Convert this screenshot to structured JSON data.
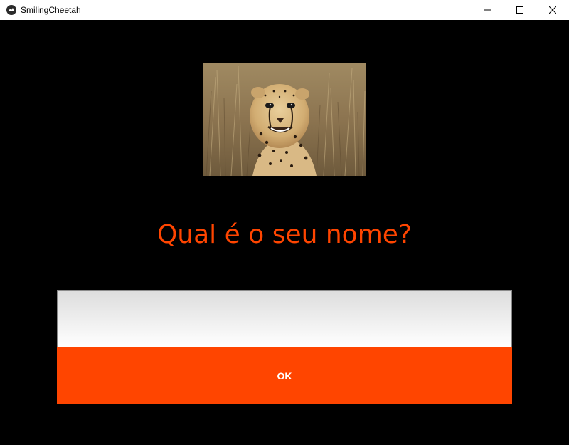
{
  "window": {
    "title": "SmilingCheetah",
    "icon": "kivy-app-icon",
    "controls": [
      "minimize-icon",
      "maximize-icon",
      "close-icon"
    ]
  },
  "image": {
    "subject": "cheetah-photo"
  },
  "prompt": {
    "question": "Qual é o seu nome?"
  },
  "name_input": {
    "value": "",
    "placeholder": ""
  },
  "ok_button": {
    "label": "OK"
  },
  "colors": {
    "accent": "#ff4500",
    "background": "#000000",
    "button_text": "#ffffff"
  }
}
